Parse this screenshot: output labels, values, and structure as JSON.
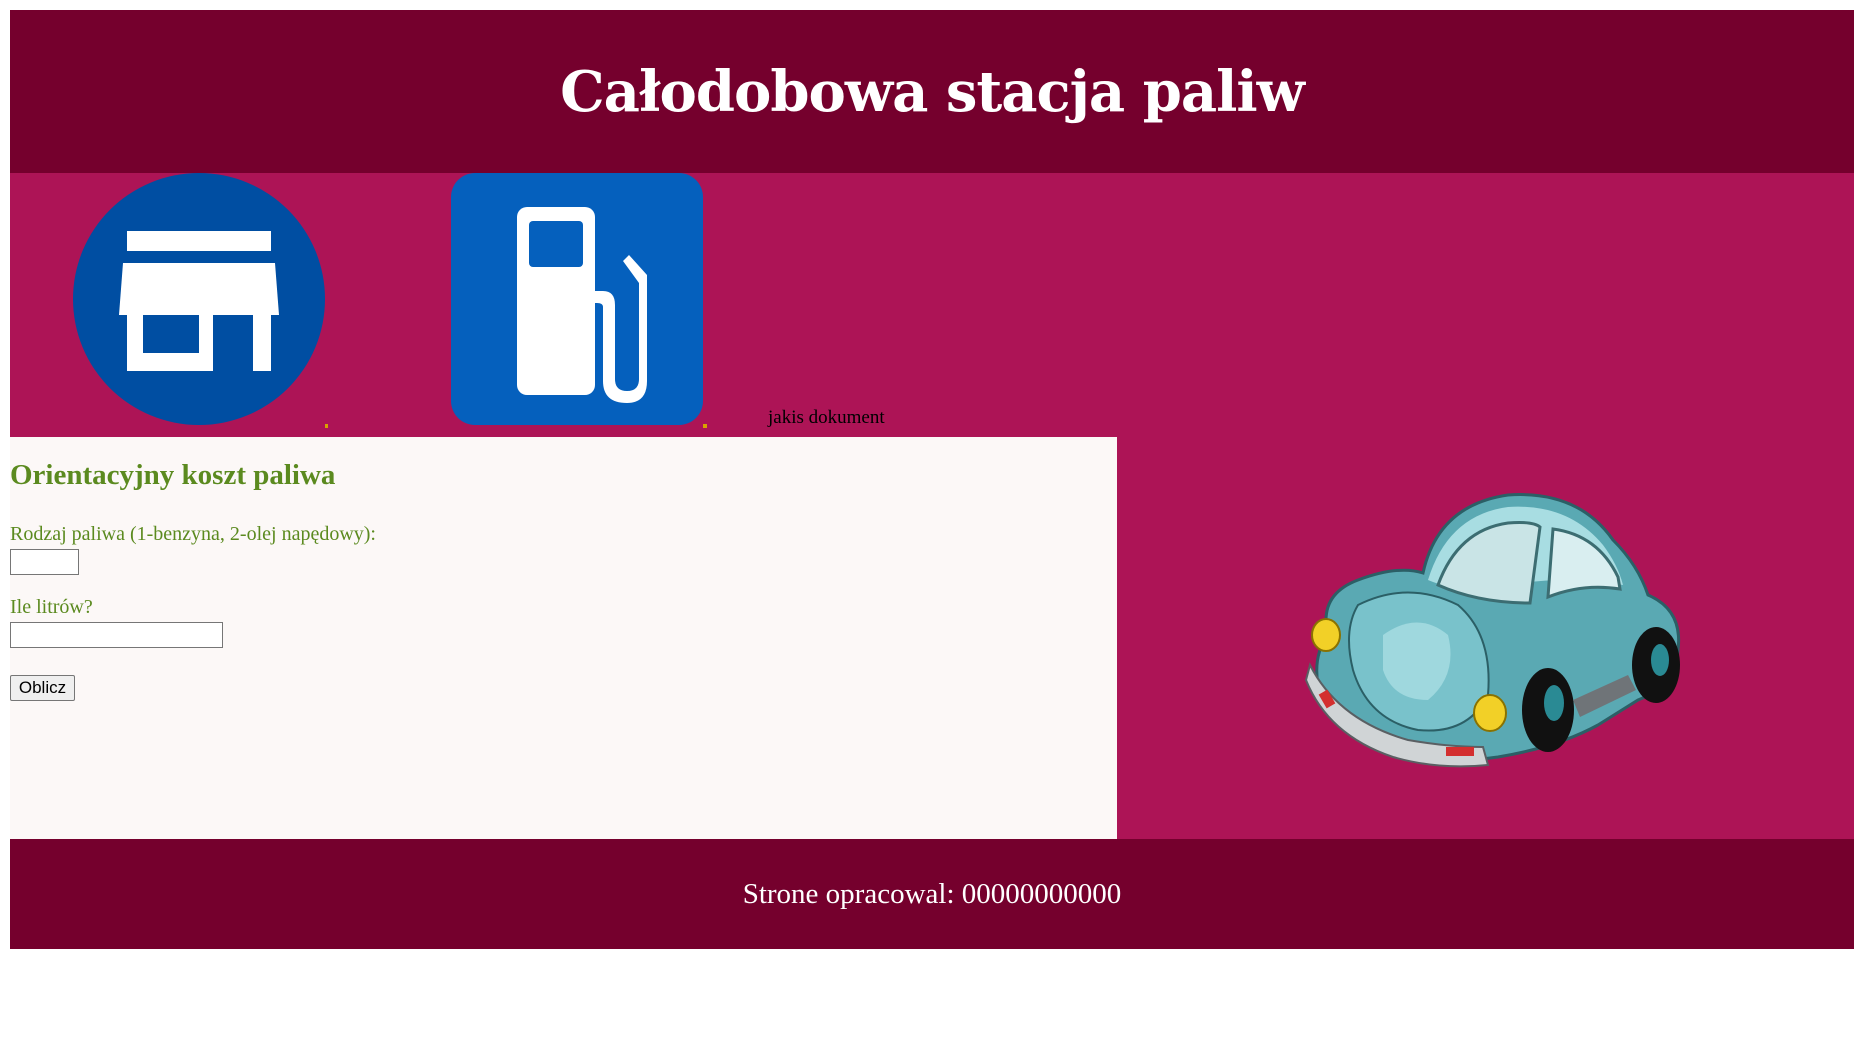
{
  "header": {
    "title": "Całodobowa stacja paliw"
  },
  "nav": {
    "shop_icon": "shop-icon",
    "fuel_icon": "fuel-pump-icon",
    "document_link": "jakis dokument"
  },
  "calculator": {
    "title": "Orientacyjny koszt paliwa",
    "fuel_type_label": "Rodzaj paliwa (1-benzyna, 2-olej napędowy):",
    "fuel_type_value": "",
    "liters_label": "Ile litrów?",
    "liters_value": "",
    "button_label": "Oblicz"
  },
  "aside": {
    "image": "car-illustration"
  },
  "footer": {
    "text": "Strone opracowal: 00000000000"
  },
  "colors": {
    "header_bg": "#75002d",
    "band_bg": "#ad1456",
    "panel_bg": "#fcf8f7",
    "heading_green": "#5b8a1f",
    "icon_blue": "#0560bd"
  }
}
